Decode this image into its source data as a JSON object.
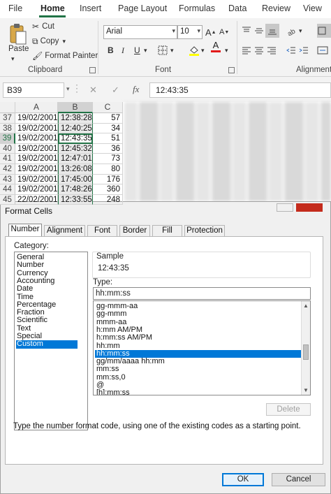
{
  "ribbon_tabs": [
    "File",
    "Home",
    "Insert",
    "Page Layout",
    "Formulas",
    "Data",
    "Review",
    "View"
  ],
  "active_tab": "Home",
  "clipboard": {
    "paste": "Paste",
    "cut": "Cut",
    "copy": "Copy",
    "format_painter": "Format Painter",
    "label": "Clipboard"
  },
  "font": {
    "name": "Arial",
    "size": "10",
    "bold": "B",
    "italic": "I",
    "underline": "U",
    "color_glyph": "A",
    "label": "Font"
  },
  "alignment": {
    "label": "Alignment"
  },
  "formula_bar": {
    "name_box": "B39",
    "cancel": "✕",
    "enter": "✓",
    "fx": "fx",
    "content": "12:43:35"
  },
  "sheet": {
    "columns": [
      "A",
      "B",
      "C"
    ],
    "rows": [
      {
        "num": "37",
        "a": "19/02/2001",
        "b": "12:38:28",
        "c": "57"
      },
      {
        "num": "38",
        "a": "19/02/2001",
        "b": "12:40:25",
        "c": "34"
      },
      {
        "num": "39",
        "a": "19/02/2001",
        "b": "12:43:35",
        "c": "51"
      },
      {
        "num": "40",
        "a": "19/02/2001",
        "b": "12:45:32",
        "c": "36"
      },
      {
        "num": "41",
        "a": "19/02/2001",
        "b": "12:47:01",
        "c": "73"
      },
      {
        "num": "42",
        "a": "19/02/2001",
        "b": "13:26:08",
        "c": "80"
      },
      {
        "num": "43",
        "a": "19/02/2001",
        "b": "17:45:00",
        "c": "176"
      },
      {
        "num": "44",
        "a": "19/02/2001",
        "b": "17:48:26",
        "c": "360"
      },
      {
        "num": "45",
        "a": "22/02/2001",
        "b": "12:33:55",
        "c": "248"
      }
    ],
    "active_row_index": 2
  },
  "dialog": {
    "title": "Format Cells",
    "tabs": [
      "Number",
      "Alignment",
      "Font",
      "Border",
      "Fill",
      "Protection"
    ],
    "selected_tab": "Number",
    "category_label": "Category:",
    "categories": [
      "General",
      "Number",
      "Currency",
      "Accounting",
      "Date",
      "Time",
      "Percentage",
      "Fraction",
      "Scientific",
      "Text",
      "Special",
      "Custom"
    ],
    "selected_category": "Custom",
    "sample_label": "Sample",
    "sample_value": "12:43:35",
    "type_label": "Type:",
    "type_value": "hh:mm:ss",
    "type_list": [
      "gg-mmm-aa",
      "gg-mmm",
      "mmm-aa",
      "h:mm AM/PM",
      "h:mm:ss AM/PM",
      "hh:mm",
      "hh:mm:ss",
      "gg/mm/aaaa hh:mm",
      "mm:ss",
      "mm:ss,0",
      "@",
      "[h]:mm:ss"
    ],
    "selected_type": "hh:mm:ss",
    "delete_label": "Delete",
    "hint": "Type the number format code, using one of the existing codes as a starting point.",
    "ok_label": "OK",
    "cancel_label": "Cancel"
  },
  "colors": {
    "excel_green": "#217346",
    "selection_blue": "#0078d7",
    "close_red": "#c42b1c"
  }
}
